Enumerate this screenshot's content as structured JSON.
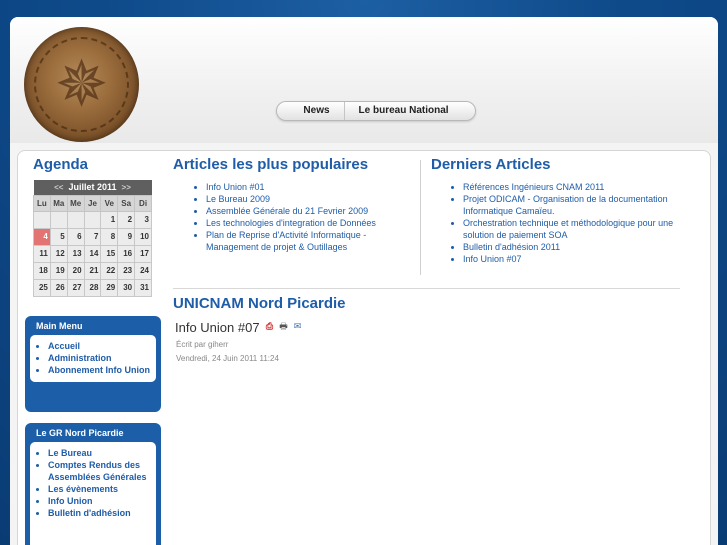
{
  "nav": {
    "items": [
      "News",
      "Le bureau National"
    ]
  },
  "agenda": {
    "title": "Agenda",
    "month_label": "Juillet 2011",
    "prev": "<<",
    "next": ">>",
    "days_of_week": [
      "Lu",
      "Ma",
      "Me",
      "Je",
      "Ve",
      "Sa",
      "Di"
    ],
    "weeks": [
      [
        "",
        "",
        "",
        "",
        "1",
        "2",
        "3"
      ],
      [
        "4",
        "5",
        "6",
        "7",
        "8",
        "9",
        "10"
      ],
      [
        "11",
        "12",
        "13",
        "14",
        "15",
        "16",
        "17"
      ],
      [
        "18",
        "19",
        "20",
        "21",
        "22",
        "23",
        "24"
      ],
      [
        "25",
        "26",
        "27",
        "28",
        "29",
        "30",
        "31"
      ]
    ],
    "today": "4",
    "today_color": "#e27474"
  },
  "main_menu": {
    "title": "Main Menu",
    "items": [
      "Accueil",
      "Administration",
      "Abonnement Info Union"
    ]
  },
  "gr_menu": {
    "title": "Le GR Nord Picardie",
    "items": [
      "Le Bureau",
      "Comptes Rendus des Assemblées Générales",
      "Les évènements",
      "Info Union",
      "Bulletin d'adhésion"
    ]
  },
  "popular": {
    "title": "Articles les plus populaires",
    "items": [
      "Info Union #01",
      "Le Bureau 2009",
      "Assemblée Générale du 21 Fevrier 2009",
      "Les technologies d'integration de Données",
      "Plan de Reprise d'Activité Informatique - Management de projet & Outillages"
    ]
  },
  "latest": {
    "title": "Derniers Articles",
    "items": [
      "Références Ingénieurs CNAM 2011",
      "Projet ODICAM - Organisation de la documentation Informatique Camaïeu.",
      "Orchestration technique et méthodologique pour une solution de paiement SOA",
      "Bulletin d'adhésion 2011",
      "Info Union #07"
    ]
  },
  "section": {
    "title": "UNICNAM Nord Picardie"
  },
  "article": {
    "title": "Info Union #07",
    "author": "Écrit par giherr",
    "date": "Vendredi, 24 Juin 2011 11:24"
  },
  "colors": {
    "accent": "#1f5da8",
    "background": "#0e4a8a"
  }
}
